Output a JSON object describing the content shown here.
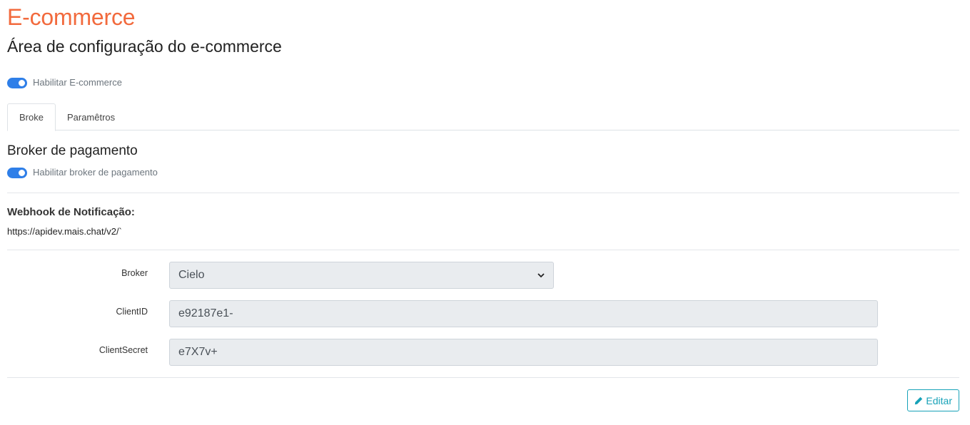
{
  "page": {
    "title": "E-commerce",
    "subtitle": "Área de configuração do e-commerce"
  },
  "ecommerce_toggle": {
    "label": "Habilitar E-commerce",
    "enabled": true
  },
  "tabs": [
    {
      "label": "Broke",
      "active": true
    },
    {
      "label": "Paramêtros",
      "active": false
    }
  ],
  "broker_section": {
    "title": "Broker de pagamento",
    "toggle": {
      "label": "Habilitar broker de pagamento",
      "enabled": true
    }
  },
  "webhook": {
    "label": "Webhook de Notificação:",
    "value": "https://apidev.mais.chat/v2/`"
  },
  "form": {
    "broker": {
      "label": "Broker",
      "value": "Cielo"
    },
    "client_id": {
      "label": "ClientID",
      "value": "e92187e1-"
    },
    "client_secret": {
      "label": "ClientSecret",
      "value": "e7X7v+"
    }
  },
  "actions": {
    "edit_label": "Editar"
  },
  "colors": {
    "title_accent": "#f26a3d",
    "toggle_on": "#2f7fe8",
    "edit_button": "#17a2b8"
  }
}
